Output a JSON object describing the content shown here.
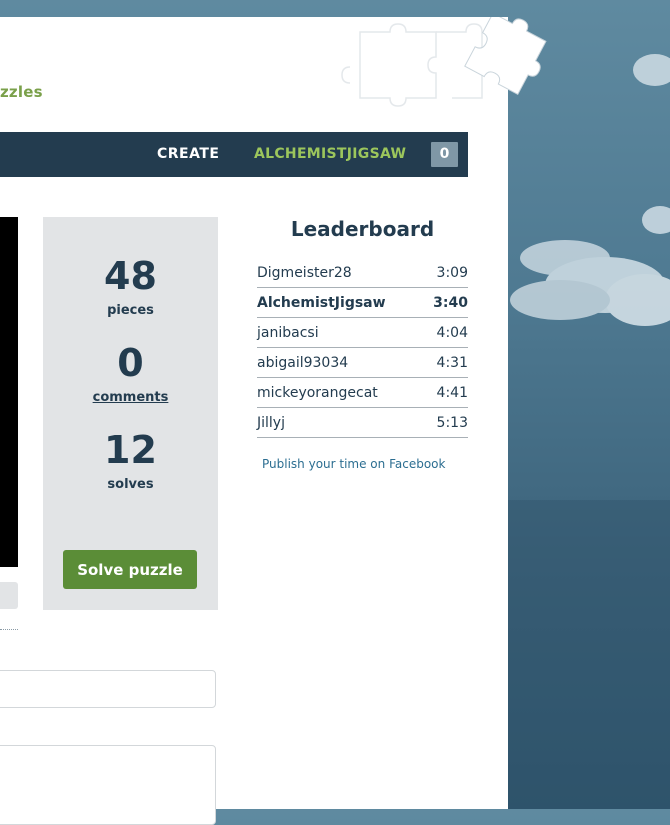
{
  "header": {
    "brand_tail": "zzles"
  },
  "nav": {
    "create_label": "CREATE",
    "user_label": "ALCHEMISTJIGSAW",
    "badge_count": "0"
  },
  "stats": {
    "pieces_value": "48",
    "pieces_label": "pieces",
    "comments_value": "0",
    "comments_label": "comments",
    "solves_value": "12",
    "solves_label": "solves",
    "solve_button_label": "Solve puzzle"
  },
  "leaderboard": {
    "title": "Leaderboard",
    "entries": [
      {
        "name": "Digmeister28",
        "time": "3:09"
      },
      {
        "name": "AlchemistJigsaw",
        "time": "3:40"
      },
      {
        "name": "janibacsi",
        "time": "4:04"
      },
      {
        "name": "abigail93034",
        "time": "4:31"
      },
      {
        "name": "mickeyorangecat",
        "time": "4:41"
      },
      {
        "name": "Jillyj",
        "time": "5:13"
      }
    ],
    "facebook_link": "Publish your time on Facebook"
  },
  "colors": {
    "navbar": "#233c4f",
    "accent_green": "#9cc65c",
    "button_green": "#5b8d37",
    "panel_gray": "#e2e4e6",
    "sky_blue": "#4f7a92"
  },
  "icons": {
    "decoration": "jigsaw-puzzle-pieces-icon"
  }
}
